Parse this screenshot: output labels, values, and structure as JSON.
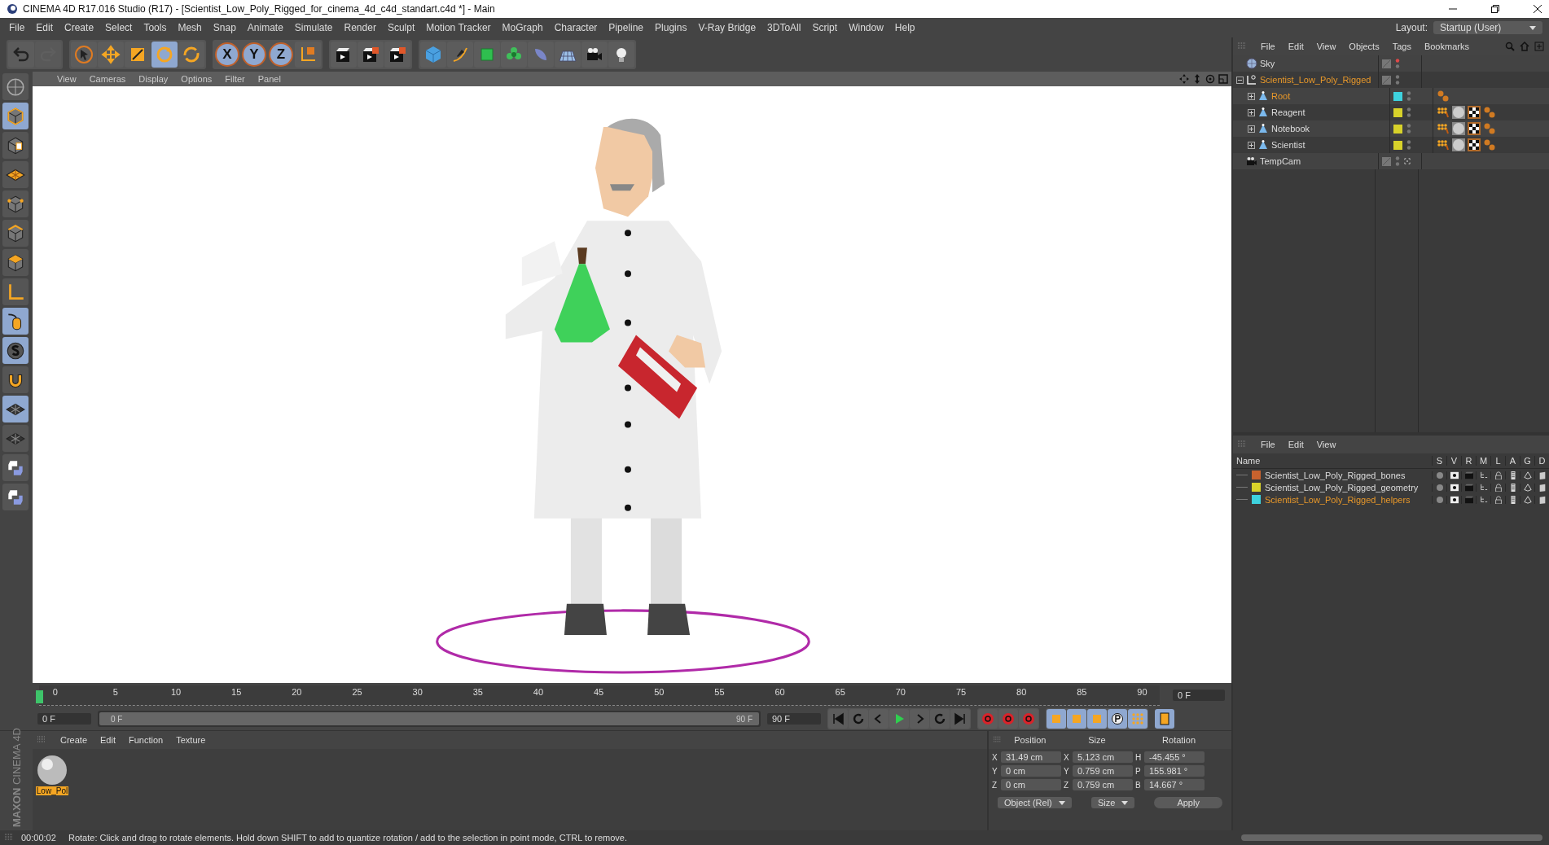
{
  "window": {
    "title": "CINEMA 4D R17.016 Studio (R17) - [Scientist_Low_Poly_Rigged_for_cinema_4d_c4d_standart.c4d *] - Main"
  },
  "menu": [
    "File",
    "Edit",
    "Create",
    "Select",
    "Tools",
    "Mesh",
    "Snap",
    "Animate",
    "Simulate",
    "Render",
    "Sculpt",
    "Motion Tracker",
    "MoGraph",
    "Character",
    "Pipeline",
    "Plugins",
    "V-Ray Bridge",
    "3DToAll",
    "Script",
    "Window",
    "Help"
  ],
  "layout": {
    "label": "Layout:",
    "value": "Startup (User)"
  },
  "tools": [
    {
      "kind": "select",
      "selected": false
    },
    {
      "kind": "move",
      "selected": false
    },
    {
      "kind": "scale",
      "selected": false
    },
    {
      "kind": "rotate",
      "selected": true
    },
    {
      "kind": "recent",
      "selected": false
    }
  ],
  "axis_buttons": [
    {
      "label": "X",
      "selected": true
    },
    {
      "label": "Y",
      "selected": true
    },
    {
      "label": "Z",
      "selected": true
    }
  ],
  "viewport": {
    "menu": [
      "View",
      "Cameras",
      "Display",
      "Options",
      "Filter",
      "Panel"
    ]
  },
  "timeline": {
    "ticks": [
      "0",
      "5",
      "10",
      "15",
      "20",
      "25",
      "30",
      "35",
      "40",
      "45",
      "50",
      "55",
      "60",
      "65",
      "70",
      "75",
      "80",
      "85",
      "90"
    ],
    "frame_field": "0 F"
  },
  "transport": {
    "level": 1,
    "start": "0 F",
    "range_start": "0 F",
    "range_end": "90 F",
    "end": "90 F"
  },
  "material_manager": {
    "menu": [
      "Create",
      "Edit",
      "Function",
      "Texture"
    ],
    "materials": [
      {
        "name": "Low_Pol",
        "selected": true
      }
    ]
  },
  "brand": {
    "top": "MAXON",
    "bottom": "CINEMA 4D"
  },
  "coordinates": {
    "headers": [
      "Position",
      "Size",
      "Rotation"
    ],
    "rows": [
      {
        "axis": "X",
        "position": "31.49 cm",
        "size_axis": "X",
        "size": "5.123 cm",
        "rot_axis": "H",
        "rotation": "-45.455 °"
      },
      {
        "axis": "Y",
        "position": "0 cm",
        "size_axis": "Y",
        "size": "0.759 cm",
        "rot_axis": "P",
        "rotation": "155.981 °"
      },
      {
        "axis": "Z",
        "position": "0 cm",
        "size_axis": "Z",
        "size": "0.759 cm",
        "rot_axis": "B",
        "rotation": "14.667 °"
      }
    ],
    "mode": "Object (Rel)",
    "size_mode": "Size",
    "apply": "Apply"
  },
  "status_bar": {
    "time": "00:00:02",
    "message": "Rotate: Click and drag to rotate elements. Hold down SHIFT to add to quantize rotation / add to the selection in point mode, CTRL to remove."
  },
  "object_manager": {
    "menu": [
      "File",
      "Edit",
      "View",
      "Objects",
      "Tags",
      "Bookmarks"
    ],
    "objects": [
      {
        "name": "Sky",
        "kind": "sky",
        "selected": false
      },
      {
        "name": "Scientist_Low_Poly_Rigged",
        "kind": "null",
        "selected": true,
        "expanded": true,
        "children": [
          {
            "name": "Root",
            "kind": "root_joint",
            "selected": true,
            "expanded": false,
            "color": "#3ed2de"
          },
          {
            "name": "Reagent",
            "kind": "joint",
            "selected": false,
            "expanded": false,
            "color": "#d8d22a"
          },
          {
            "name": "Notebook",
            "kind": "joint",
            "selected": false,
            "expanded": false,
            "color": "#d8d22a"
          },
          {
            "name": "Scientist",
            "kind": "joint",
            "selected": false,
            "expanded": false,
            "color": "#d8d22a"
          }
        ]
      },
      {
        "name": "TempCam",
        "kind": "camera",
        "selected": false
      }
    ]
  },
  "layer_manager": {
    "menu": [
      "File",
      "Edit",
      "View"
    ],
    "columns": [
      "Name",
      "S",
      "V",
      "R",
      "M",
      "L",
      "A",
      "G",
      "D"
    ],
    "layers": [
      {
        "name": "Scientist_Low_Poly_Rigged_bones",
        "color": "#c8622e",
        "selected": false
      },
      {
        "name": "Scientist_Low_Poly_Rigged_geometry",
        "color": "#d8d22a",
        "selected": false
      },
      {
        "name": "Scientist_Low_Poly_Rigged_helpers",
        "color": "#3ed2de",
        "selected": true
      }
    ]
  }
}
